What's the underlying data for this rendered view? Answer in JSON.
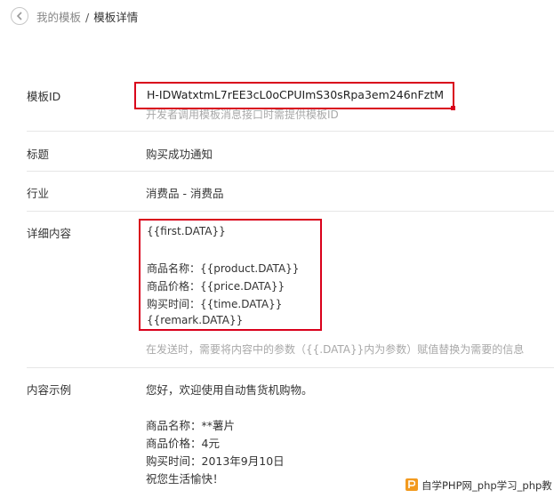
{
  "breadcrumb": {
    "parent": "我的模板",
    "separator": "/",
    "current": "模板详情"
  },
  "template_id": {
    "label": "模板ID",
    "value": "H-IDWatxtmL7rEE3cL0oCPUImS30sRpa3em246nFztM",
    "hint": "开发者调用模板消息接口时需提供模板ID"
  },
  "title": {
    "label": "标题",
    "value": "购买成功通知"
  },
  "industry": {
    "label": "行业",
    "value": "消费品 - 消费品"
  },
  "detail": {
    "label": "详细内容",
    "lines": [
      "{{first.DATA}}",
      "",
      "商品名称：{{product.DATA}}",
      "商品价格：{{price.DATA}}",
      "购买时间：{{time.DATA}}",
      "{{remark.DATA}}"
    ],
    "hint": "在发送时，需要将内容中的参数（{{.DATA}}内为参数）赋值替换为需要的信息"
  },
  "sample": {
    "label": "内容示例",
    "lines": [
      "您好，欢迎使用自动售货机购物。",
      "",
      "商品名称：**薯片",
      "商品价格：4元",
      "购买时间：2013年9月10日",
      "祝您生活愉快！"
    ]
  },
  "watermark": {
    "text": "自学PHP网_php学习_php教"
  },
  "colors": {
    "highlight_box": "#d9001b",
    "hint_text": "#a8a8a8",
    "divider": "#e6e6e6",
    "watermark_logo": "#f29a1f"
  },
  "icons": {
    "back": "chevron-left-icon",
    "watermark_logo": "php-logo-icon"
  }
}
